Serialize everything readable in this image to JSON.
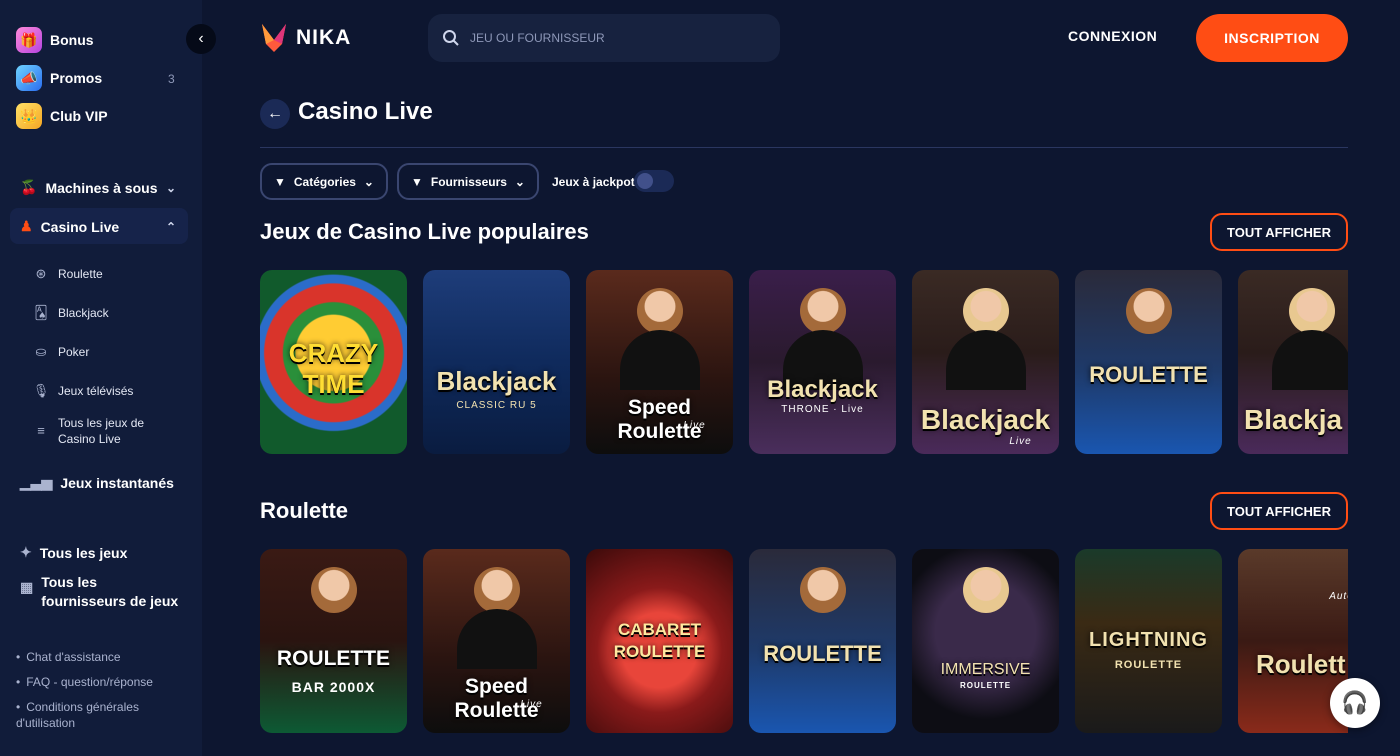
{
  "sidebar": {
    "promos": [
      {
        "label": "Bonus",
        "icon": "gift-icon",
        "count": ""
      },
      {
        "label": "Promos",
        "icon": "megaphone-icon",
        "count": "3"
      },
      {
        "label": "Club VIP",
        "icon": "crown-icon",
        "count": ""
      }
    ],
    "nav": {
      "slots": "Machines à sous",
      "casino_live": "Casino Live",
      "sub": [
        "Roulette",
        "Blackjack",
        "Poker",
        "Jeux télévisés",
        "Tous les jeux de Casino Live"
      ],
      "instant": "Jeux instantanés",
      "all_games": "Tous les jeux",
      "all_providers": "Tous les fournisseurs de jeux"
    },
    "footer": [
      "Chat d'assistance",
      "FAQ - question/réponse",
      "Conditions générales d'utilisation"
    ]
  },
  "header": {
    "brand": "NIKA",
    "search_placeholder": "JEU OU FOURNISSEUR",
    "login": "CONNEXION",
    "signup": "INSCRIPTION"
  },
  "page": {
    "title": "Casino Live",
    "filters": {
      "categories": "Catégories",
      "providers": "Fournisseurs",
      "jackpot": "Jeux à jackpot"
    }
  },
  "sections": [
    {
      "title": "Jeux de Casino Live populaires",
      "see_all": "TOUT AFFICHER",
      "games": [
        {
          "t1": "CRAZY TIME",
          "t2": ""
        },
        {
          "t1": "Blackjack",
          "t2": "CLASSIC RU 5"
        },
        {
          "t1": "Speed Roulette",
          "t2": "Live"
        },
        {
          "t1": "Blackjack",
          "t2": "THRONE · Live"
        },
        {
          "t1": "Blackjack",
          "t2": "Live"
        },
        {
          "t1": "ROULETTE",
          "t2": ""
        },
        {
          "t1": "Blackja",
          "t2": ""
        }
      ]
    },
    {
      "title": "Roulette",
      "see_all": "TOUT AFFICHER",
      "games": [
        {
          "t1": "ROULETTE",
          "t2": "BAR 2000X"
        },
        {
          "t1": "Speed Roulette",
          "t2": "Live"
        },
        {
          "t1": "CABARET ROULETTE",
          "t2": ""
        },
        {
          "t1": "ROULETTE",
          "t2": ""
        },
        {
          "t1": "IMMERSIVE",
          "t2": "ROULETTE"
        },
        {
          "t1": "LIGHTNING",
          "t2": "ROULETTE"
        },
        {
          "t1": "Roulett",
          "t2": "Auto"
        }
      ]
    }
  ],
  "colors": {
    "accent": "#ff4d14",
    "background": "#0d1630",
    "sidebar": "#111c3a"
  }
}
